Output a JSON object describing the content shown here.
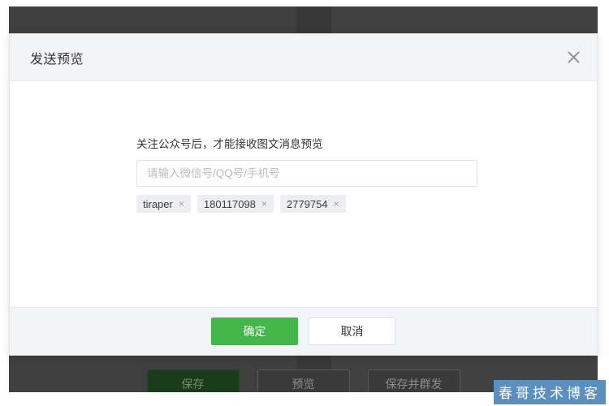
{
  "dialog": {
    "title": "发送预览",
    "close_icon": "close-icon",
    "form": {
      "label": "关注公众号后，才能接收图文消息预览",
      "input_value": "",
      "input_placeholder": "请输入微信号/QQ号/手机号",
      "tags": [
        {
          "label": "tiraper",
          "remove": "×"
        },
        {
          "label": "180117098",
          "remove": "×"
        },
        {
          "label": "2779754",
          "remove": "×"
        }
      ]
    },
    "footer": {
      "confirm_label": "确定",
      "cancel_label": "取消"
    }
  },
  "page": {
    "actions": [
      {
        "label": "保存",
        "style": "primary"
      },
      {
        "label": "预览",
        "style": "default"
      },
      {
        "label": "保存并群发",
        "style": "default"
      }
    ]
  },
  "watermark": {
    "text": "春哥技术博客"
  },
  "colors": {
    "accent_green": "#44b549",
    "header_bg": "#f2f4f8",
    "overlay": "#424242",
    "tag_bg": "#eceef1",
    "watermark_bg": "#5b8fbe"
  }
}
